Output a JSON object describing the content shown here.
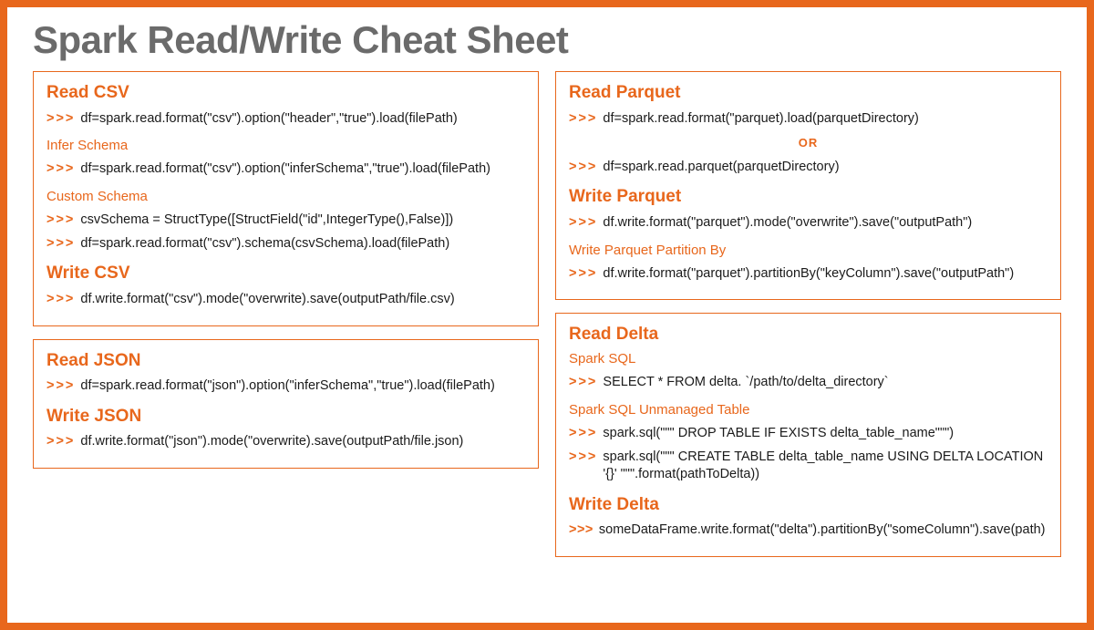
{
  "title": "Spark Read/Write Cheat Sheet",
  "prompt": ">>>",
  "or": "OR",
  "csv": {
    "readHeading": "Read CSV",
    "read1": "df=spark.read.format(\"csv\").option(\"header\",\"true\").load(filePath)",
    "inferLabel": "Infer Schema",
    "infer": "df=spark.read.format(\"csv\").option(\"inferSchema\",\"true\").load(filePath)",
    "customLabel": "Custom Schema",
    "custom1": "csvSchema = StructType([StructField(\"id\",IntegerType(),False)])",
    "custom2": "df=spark.read.format(\"csv\").schema(csvSchema).load(filePath)",
    "writeHeading": "Write CSV",
    "write": "df.write.format(\"csv\").mode(\"overwrite).save(outputPath/file.csv)"
  },
  "json": {
    "readHeading": "Read JSON",
    "read": "df=spark.read.format(\"json\").option(\"inferSchema\",\"true\").load(filePath)",
    "writeHeading": "Write JSON",
    "write": "df.write.format(\"json\").mode(\"overwrite).save(outputPath/file.json)"
  },
  "parquet": {
    "readHeading": "Read Parquet",
    "read1": "df=spark.read.format(\"parquet).load(parquetDirectory)",
    "read2": "df=spark.read.parquet(parquetDirectory)",
    "writeHeading": "Write Parquet",
    "write": "df.write.format(\"parquet\").mode(\"overwrite\").save(\"outputPath\")",
    "partitionLabel": "Write Parquet Partition By",
    "partition": "df.write.format(\"parquet\").partitionBy(\"keyColumn\").save(\"outputPath\")"
  },
  "delta": {
    "readHeading": "Read Delta",
    "sqlLabel": "Spark SQL",
    "sql": "SELECT * FROM delta. `/path/to/delta_directory`",
    "unmanagedLabel": "Spark SQL Unmanaged Table",
    "un1": "spark.sql(\"\"\" DROP TABLE IF EXISTS delta_table_name\"\"\")",
    "un2": "spark.sql(\"\"\" CREATE TABLE delta_table_name USING DELTA LOCATION '{}' \"\"\".format(pathToDelta))",
    "writeHeading": "Write Delta",
    "write": "someDataFrame.write.format(\"delta\").partitionBy(\"someColumn\").save(path)"
  }
}
